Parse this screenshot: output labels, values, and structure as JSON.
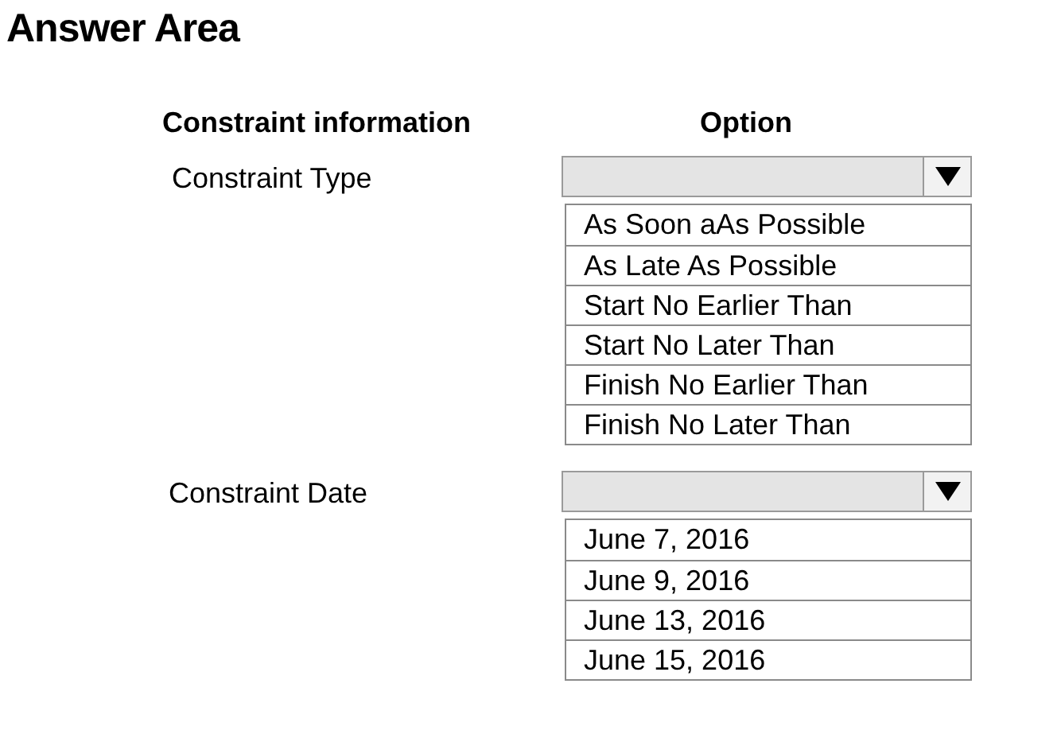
{
  "title": "Answer Area",
  "headers": [
    "Constraint information",
    "Option"
  ],
  "rows": [
    {
      "label": "Constraint Type",
      "options": [
        {
          "text": "As Soon aAs Possible",
          "selected": false
        },
        {
          "text": "As Late As Possible",
          "selected": false
        },
        {
          "text": "Start No Earlier Than",
          "selected": false
        },
        {
          "text": "Start No Later Than",
          "selected": false
        },
        {
          "text": "Finish No Earlier Than",
          "selected": false
        },
        {
          "text": "Finish No Later Than",
          "selected": false
        }
      ]
    },
    {
      "label": "Constraint Date",
      "options": [
        {
          "text": "June 7, 2016",
          "selected": false
        },
        {
          "text": "June 9, 2016",
          "selected": false
        },
        {
          "text": "June 13, 2016",
          "selected": false
        },
        {
          "text": "June 15, 2016",
          "selected": false
        }
      ]
    }
  ]
}
